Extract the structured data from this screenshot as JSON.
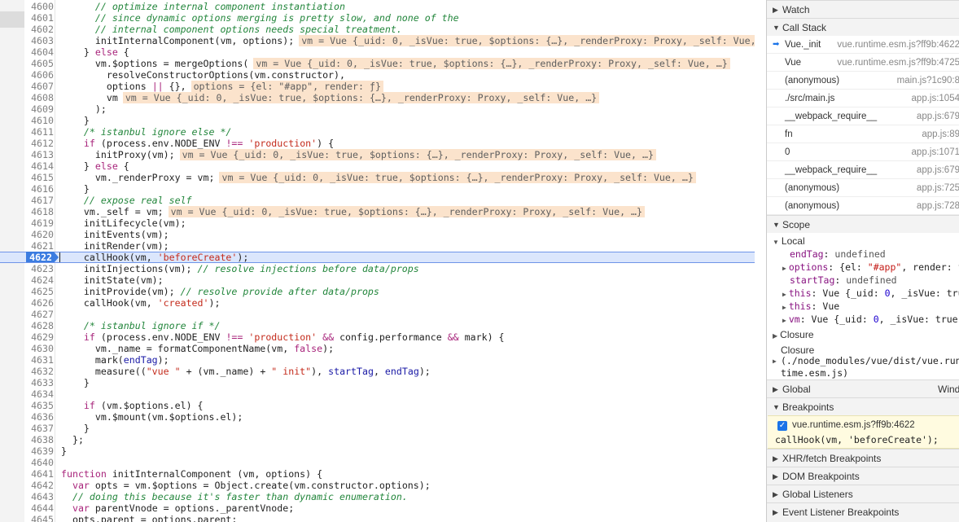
{
  "editor": {
    "current_line": "4622",
    "lines": [
      {
        "n": "4600",
        "t": [
          [
            "cm",
            "      // optimize internal component instantiation"
          ]
        ]
      },
      {
        "n": "4601",
        "t": [
          [
            "cm",
            "      // since dynamic options merging is pretty slow, and none of the"
          ]
        ]
      },
      {
        "n": "4602",
        "t": [
          [
            "cm",
            "      // internal component options needs special treatment."
          ]
        ]
      },
      {
        "n": "4603",
        "t": [
          [
            "pl",
            "      initInternalComponent(vm, options);"
          ],
          [
            "hint",
            "vm = Vue {_uid: 0, _isVue: true, $options: {…}, _renderProxy: Proxy, _self: Vue, …}"
          ]
        ]
      },
      {
        "n": "4604",
        "t": [
          [
            "pl",
            "    } "
          ],
          [
            "kw",
            "else"
          ],
          [
            "pl",
            " {"
          ]
        ]
      },
      {
        "n": "4605",
        "t": [
          [
            "pl",
            "      vm.$options = mergeOptions("
          ],
          [
            "hint",
            "vm = Vue {_uid: 0, _isVue: true, $options: {…}, _renderProxy: Proxy, _self: Vue, …}"
          ]
        ]
      },
      {
        "n": "4606",
        "t": [
          [
            "pl",
            "        resolveConstructorOptions(vm.constructor),"
          ]
        ]
      },
      {
        "n": "4607",
        "t": [
          [
            "pl",
            "        options "
          ],
          [
            "kw",
            "||"
          ],
          [
            "pl",
            " {},"
          ],
          [
            "hint",
            "options = {el: \"#app\", render: ƒ}"
          ]
        ]
      },
      {
        "n": "4608",
        "t": [
          [
            "pl",
            "        vm"
          ],
          [
            "hint",
            "vm = Vue {_uid: 0, _isVue: true, $options: {…}, _renderProxy: Proxy, _self: Vue, …}"
          ]
        ]
      },
      {
        "n": "4609",
        "t": [
          [
            "pl",
            "      );"
          ]
        ]
      },
      {
        "n": "4610",
        "t": [
          [
            "pl",
            "    }"
          ]
        ]
      },
      {
        "n": "4611",
        "t": [
          [
            "cm",
            "    /* istanbul ignore else */"
          ]
        ]
      },
      {
        "n": "4612",
        "t": [
          [
            "pl",
            "    "
          ],
          [
            "kw",
            "if"
          ],
          [
            "pl",
            " (process.env.NODE_ENV "
          ],
          [
            "kw",
            "!=="
          ],
          [
            "pl",
            " "
          ],
          [
            "str",
            "'production'"
          ],
          [
            "pl",
            ") {"
          ]
        ]
      },
      {
        "n": "4613",
        "t": [
          [
            "pl",
            "      initProxy(vm);"
          ],
          [
            "hint",
            "vm = Vue {_uid: 0, _isVue: true, $options: {…}, _renderProxy: Proxy, _self: Vue, …}"
          ]
        ]
      },
      {
        "n": "4614",
        "t": [
          [
            "pl",
            "    } "
          ],
          [
            "kw",
            "else"
          ],
          [
            "pl",
            " {"
          ]
        ]
      },
      {
        "n": "4615",
        "t": [
          [
            "pl",
            "      vm._renderProxy = vm;"
          ],
          [
            "hint",
            "vm = Vue {_uid: 0, _isVue: true, $options: {…}, _renderProxy: Proxy, _self: Vue, …}"
          ]
        ]
      },
      {
        "n": "4616",
        "t": [
          [
            "pl",
            "    }"
          ]
        ]
      },
      {
        "n": "4617",
        "t": [
          [
            "cm",
            "    // expose real self"
          ]
        ]
      },
      {
        "n": "4618",
        "t": [
          [
            "pl",
            "    vm._self = vm;"
          ],
          [
            "hint",
            "vm = Vue {_uid: 0, _isVue: true, $options: {…}, _renderProxy: Proxy, _self: Vue, …}"
          ]
        ]
      },
      {
        "n": "4619",
        "t": [
          [
            "pl",
            "    initLifecycle(vm);"
          ]
        ]
      },
      {
        "n": "4620",
        "t": [
          [
            "pl",
            "    initEvents(vm);"
          ]
        ]
      },
      {
        "n": "4621",
        "t": [
          [
            "pl",
            "    initRender(vm);"
          ]
        ]
      },
      {
        "n": "4622",
        "t": [
          [
            "pl",
            "    callHook(vm, "
          ],
          [
            "str",
            "'beforeCreate'"
          ],
          [
            "pl",
            ");"
          ]
        ]
      },
      {
        "n": "4623",
        "t": [
          [
            "pl",
            "    initInjections(vm); "
          ],
          [
            "cm",
            "// resolve injections before data/props"
          ]
        ]
      },
      {
        "n": "4624",
        "t": [
          [
            "pl",
            "    initState(vm);"
          ]
        ]
      },
      {
        "n": "4625",
        "t": [
          [
            "pl",
            "    initProvide(vm); "
          ],
          [
            "cm",
            "// resolve provide after data/props"
          ]
        ]
      },
      {
        "n": "4626",
        "t": [
          [
            "pl",
            "    callHook(vm, "
          ],
          [
            "str",
            "'created'"
          ],
          [
            "pl",
            ");"
          ]
        ]
      },
      {
        "n": "4627",
        "t": [
          [
            "pl",
            ""
          ]
        ]
      },
      {
        "n": "4628",
        "t": [
          [
            "cm",
            "    /* istanbul ignore if */"
          ]
        ]
      },
      {
        "n": "4629",
        "t": [
          [
            "pl",
            "    "
          ],
          [
            "kw",
            "if"
          ],
          [
            "pl",
            " (process.env.NODE_ENV "
          ],
          [
            "kw",
            "!=="
          ],
          [
            "pl",
            " "
          ],
          [
            "str",
            "'production'"
          ],
          [
            "pl",
            " "
          ],
          [
            "kw",
            "&&"
          ],
          [
            "pl",
            " config.performance "
          ],
          [
            "kw",
            "&&"
          ],
          [
            "pl",
            " mark) {"
          ]
        ]
      },
      {
        "n": "4630",
        "t": [
          [
            "pl",
            "      vm._name = formatComponentName(vm, "
          ],
          [
            "kw",
            "false"
          ],
          [
            "pl",
            ");"
          ]
        ]
      },
      {
        "n": "4631",
        "t": [
          [
            "pl",
            "      mark("
          ],
          [
            "var",
            "endTag"
          ],
          [
            "pl",
            ");"
          ]
        ]
      },
      {
        "n": "4632",
        "t": [
          [
            "pl",
            "      measure(("
          ],
          [
            "str",
            "\"vue \""
          ],
          [
            "pl",
            " + (vm._name) + "
          ],
          [
            "str",
            "\" init\""
          ],
          [
            "pl",
            "), "
          ],
          [
            "var",
            "startTag"
          ],
          [
            "pl",
            ", "
          ],
          [
            "var",
            "endTag"
          ],
          [
            "pl",
            ");"
          ]
        ]
      },
      {
        "n": "4633",
        "t": [
          [
            "pl",
            "    }"
          ]
        ]
      },
      {
        "n": "4634",
        "t": [
          [
            "pl",
            ""
          ]
        ]
      },
      {
        "n": "4635",
        "t": [
          [
            "pl",
            "    "
          ],
          [
            "kw",
            "if"
          ],
          [
            "pl",
            " (vm.$options.el) {"
          ]
        ]
      },
      {
        "n": "4636",
        "t": [
          [
            "pl",
            "      vm.$mount(vm.$options.el);"
          ]
        ]
      },
      {
        "n": "4637",
        "t": [
          [
            "pl",
            "    }"
          ]
        ]
      },
      {
        "n": "4638",
        "t": [
          [
            "pl",
            "  };"
          ]
        ]
      },
      {
        "n": "4639",
        "t": [
          [
            "pl",
            "}"
          ]
        ]
      },
      {
        "n": "4640",
        "t": [
          [
            "pl",
            ""
          ]
        ]
      },
      {
        "n": "4641",
        "t": [
          [
            "kw",
            "function"
          ],
          [
            "pl",
            " initInternalComponent (vm, options) {"
          ]
        ]
      },
      {
        "n": "4642",
        "t": [
          [
            "pl",
            "  "
          ],
          [
            "kw",
            "var"
          ],
          [
            "pl",
            " opts = vm.$options = Object.create(vm.constructor.options);"
          ]
        ]
      },
      {
        "n": "4643",
        "t": [
          [
            "cm",
            "  // doing this because it's faster than dynamic enumeration."
          ]
        ]
      },
      {
        "n": "4644",
        "t": [
          [
            "pl",
            "  "
          ],
          [
            "kw",
            "var"
          ],
          [
            "pl",
            " parentVnode = options._parentVnode;"
          ]
        ]
      },
      {
        "n": "4645",
        "t": [
          [
            "pl",
            "  opts.parent = options.parent;"
          ]
        ]
      }
    ]
  },
  "sidebar": {
    "watch_label": "Watch",
    "callstack_label": "Call Stack",
    "frames": [
      {
        "name": "Vue._init",
        "loc": "vue.runtime.esm.js?ff9b:4622",
        "current": true
      },
      {
        "name": "Vue",
        "loc": "vue.runtime.esm.js?ff9b:4725"
      },
      {
        "name": "(anonymous)",
        "loc": "main.js?1c90:8"
      },
      {
        "name": "./src/main.js",
        "loc": "app.js:1054"
      },
      {
        "name": "__webpack_require__",
        "loc": "app.js:679"
      },
      {
        "name": "fn",
        "loc": "app.js:89"
      },
      {
        "name": "0",
        "loc": "app.js:1071"
      },
      {
        "name": "__webpack_require__",
        "loc": "app.js:679"
      },
      {
        "name": "(anonymous)",
        "loc": "app.js:725"
      },
      {
        "name": "(anonymous)",
        "loc": "app.js:728"
      }
    ],
    "scope_label": "Scope",
    "local_label": "Local",
    "scope_vars": {
      "endTag_name": "endTag",
      "endTag_val": "undefined",
      "options_name": "options",
      "options_val_a": "{el: ",
      "options_val_b": "\"#app\"",
      "options_val_c": ", render: ƒ}",
      "startTag_name": "startTag",
      "startTag_val": "undefined",
      "this1_name": "this",
      "this1_val_a": "Vue {_uid: ",
      "this1_val_b": "0",
      "this1_val_c": ", _isVue: true, …}",
      "this2_name": "this",
      "this2_val": "Vue",
      "vm_name": "vm",
      "vm_val_a": "Vue {_uid: ",
      "vm_val_b": "0",
      "vm_val_c": ", _isVue: true, …}"
    },
    "closure_label": "Closure",
    "closure2_label": "Closure",
    "closure2_path": "(./node_modules/vue/dist/vue.runtime.esm.js)",
    "global_label": "Global",
    "global_value": "Window",
    "breakpoints_label": "Breakpoints",
    "bp_file": "vue.runtime.esm.js?ff9b:4622",
    "bp_code": "callHook(vm, 'beforeCreate');",
    "xhr_label": "XHR/fetch Breakpoints",
    "dom_label": "DOM Breakpoints",
    "global_listeners_label": "Global Listeners",
    "event_listener_label": "Event Listener Breakpoints"
  }
}
